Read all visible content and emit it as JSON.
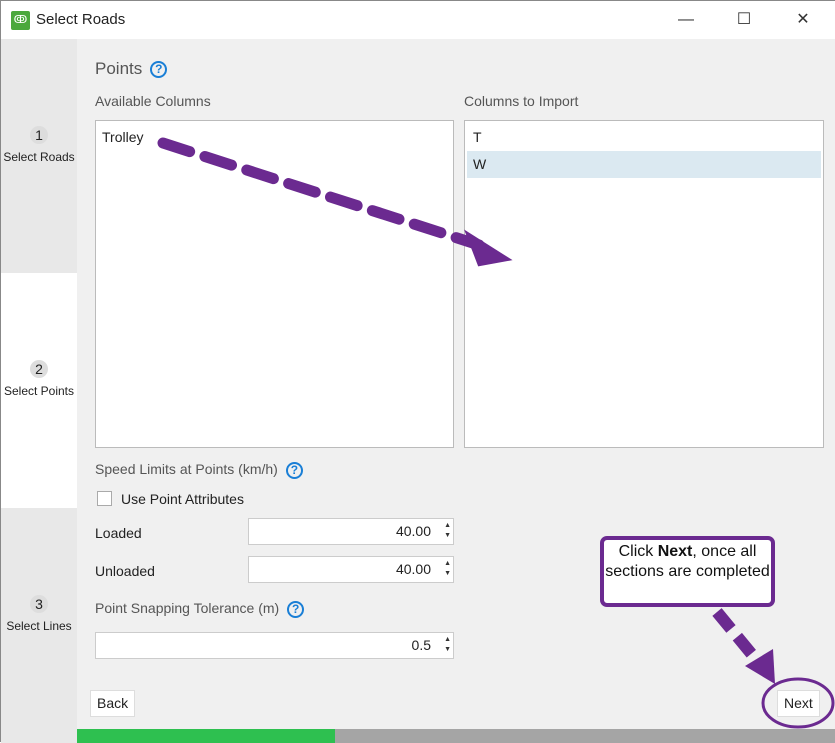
{
  "window": {
    "title": "Select Roads",
    "minimize": "—",
    "maximize": "☐",
    "close": "✕"
  },
  "steps": [
    {
      "num": "1",
      "label": "Select Roads"
    },
    {
      "num": "2",
      "label": "Select Points"
    },
    {
      "num": "3",
      "label": "Select Lines"
    }
  ],
  "section_title": "Points",
  "help": "?",
  "available_label": "Available Columns",
  "available": [
    "Trolley"
  ],
  "import_label": "Columns to Import",
  "import": [
    "T",
    "W"
  ],
  "speed_label": "Speed Limits at Points (km/h)",
  "use_attr": "Use Point Attributes",
  "loaded_label": "Loaded",
  "loaded": "40.00",
  "unloaded_label": "Unloaded",
  "unloaded": "40.00",
  "snap_label": "Point Snapping Tolerance (m)",
  "snap": "0.5",
  "back": "Back",
  "next": "Next",
  "progress": 0.34,
  "callout": {
    "pre": "Click ",
    "bold": "Next",
    "post": ", once all sections are completed"
  },
  "colors": {
    "accent": "#6b2a90",
    "progress": "#2ec050"
  }
}
